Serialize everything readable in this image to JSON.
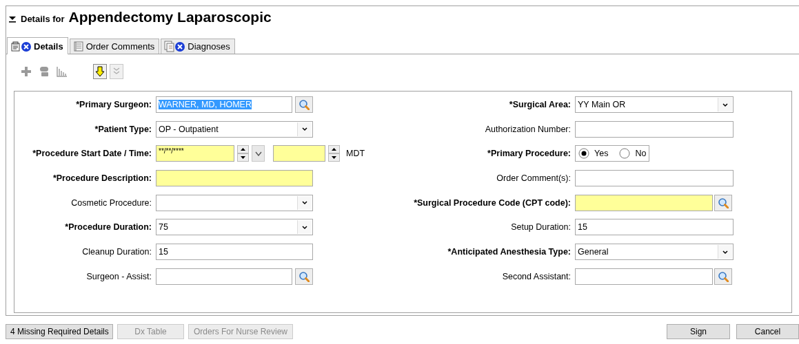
{
  "header": {
    "prefix": "Details for",
    "title": "Appendectomy Laparoscopic"
  },
  "tabs": [
    {
      "label": "Details",
      "selected": true,
      "error": true
    },
    {
      "label": "Order Comments",
      "selected": false,
      "error": false
    },
    {
      "label": "Diagnoses",
      "selected": false,
      "error": true
    }
  ],
  "toolbar": [
    {
      "disabled": true
    },
    {
      "disabled": true
    },
    {
      "disabled": true
    },
    {
      "disabled": false
    },
    {
      "disabled": true
    }
  ],
  "fields": [
    {
      "kind": "lookup",
      "label": "*Primary Surgeon:",
      "required": true,
      "value": "WARNER, MD, HOMER",
      "text_selected": true,
      "highlighted": false
    },
    {
      "kind": "dropdown",
      "label": "*Surgical Area:",
      "required": true,
      "value": "YY Main OR",
      "highlighted": false
    },
    {
      "kind": "dropdown",
      "label": "*Patient Type:",
      "required": true,
      "value": "OP - Outpatient",
      "highlighted": false
    },
    {
      "kind": "text",
      "label": "Authorization Number:",
      "required": false,
      "highlighted": false
    },
    {
      "kind": "datetime",
      "label": "*Procedure Start Date / Time:",
      "required": true,
      "value": "**/**/****",
      "timezone": "MDT",
      "highlighted": true
    },
    {
      "kind": "radio",
      "label": "*Primary Procedure:",
      "required": true,
      "options": [
        {
          "label": "Yes",
          "selected": true
        },
        {
          "label": "No",
          "selected": false
        }
      ]
    },
    {
      "kind": "text",
      "label": "*Procedure Description:",
      "required": true,
      "highlighted": true
    },
    {
      "kind": "text",
      "label": "Order Comment(s):",
      "required": false,
      "highlighted": false
    },
    {
      "kind": "dropdown",
      "label": "Cosmetic Procedure:",
      "required": false,
      "highlighted": false
    },
    {
      "kind": "lookup",
      "label": "*Surgical Procedure Code (CPT code):",
      "required": true,
      "highlighted": true
    },
    {
      "kind": "dropdown",
      "label": "*Procedure Duration:",
      "required": true,
      "value": "75",
      "highlighted": false
    },
    {
      "kind": "text",
      "label": "Setup Duration:",
      "required": false,
      "value": "15",
      "highlighted": false
    },
    {
      "kind": "text",
      "label": "Cleanup Duration:",
      "required": false,
      "value": "15",
      "highlighted": false
    },
    {
      "kind": "dropdown",
      "label": "*Anticipated Anesthesia Type:",
      "required": true,
      "value": "General",
      "highlighted": false
    },
    {
      "kind": "lookup",
      "label": "Surgeon - Assist:",
      "required": false,
      "highlighted": false
    },
    {
      "kind": "lookup",
      "label": "Second Assistant:",
      "required": false,
      "highlighted": false
    }
  ],
  "footer": {
    "left_buttons": [
      {
        "label": "4 Missing Required Details",
        "disabled": false
      },
      {
        "label": "Dx Table",
        "disabled": true
      },
      {
        "label": "Orders For Nurse Review",
        "disabled": true
      }
    ],
    "right_buttons": [
      {
        "label": "Sign",
        "disabled": false
      },
      {
        "label": "Cancel",
        "disabled": false
      }
    ]
  }
}
